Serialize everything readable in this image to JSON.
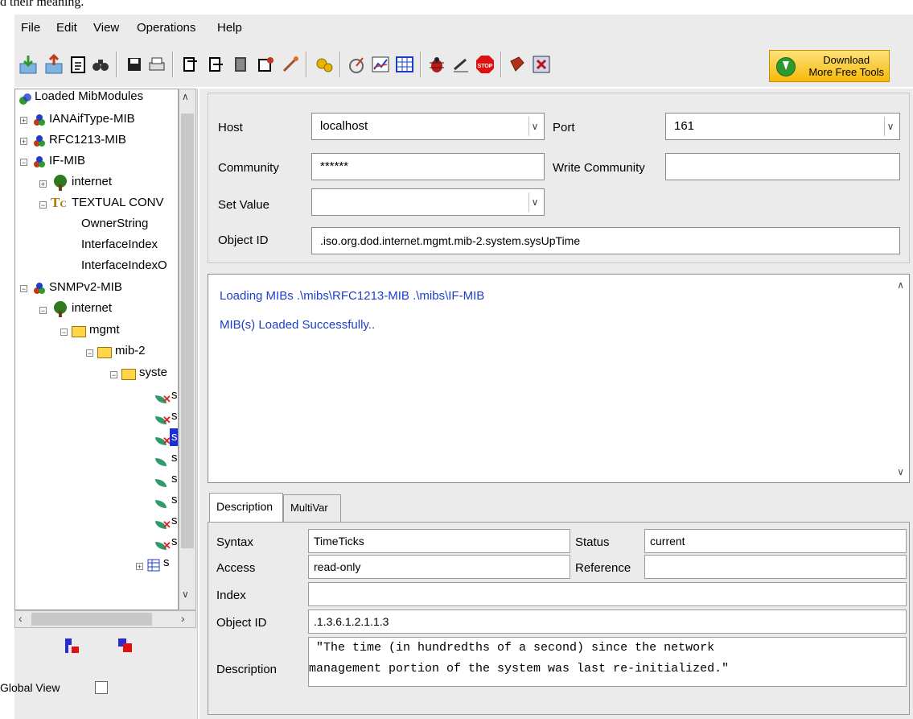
{
  "top_clip_text": "d their meaning.",
  "menu": [
    "File",
    "Edit",
    "View",
    "Operations",
    "Help"
  ],
  "toolbar": {
    "download_line1": "Download",
    "download_line2": "More Free Tools"
  },
  "tree": {
    "root": "Loaded MibModules",
    "items": [
      "IANAifType-MIB",
      "RFC1213-MIB",
      "IF-MIB",
      "internet",
      "TEXTUAL CONV",
      "OwnerString",
      "InterfaceIndex",
      "InterfaceIndexO",
      "SNMPv2-MIB",
      "internet",
      "mgmt",
      "mib-2",
      "syste",
      "s",
      "s",
      "s",
      "s",
      "s",
      "s",
      "s",
      "s",
      "s"
    ]
  },
  "form": {
    "host_label": "Host",
    "host_value": "localhost",
    "port_label": "Port",
    "port_value": "161",
    "community_label": "Community",
    "community_value": "******",
    "write_community_label": "Write Community",
    "write_community_value": "",
    "set_value_label": "Set Value",
    "set_value_value": "",
    "oid_label": "Object ID",
    "oid_value": ".iso.org.dod.internet.mgmt.mib-2.system.sysUpTime"
  },
  "log": [
    "Loading MIBs .\\mibs\\RFC1213-MIB .\\mibs\\IF-MIB",
    "MIB(s) Loaded Successfully.."
  ],
  "tabs": [
    "Description",
    "MultiVar"
  ],
  "details": {
    "syntax_label": "Syntax",
    "syntax_value": "TimeTicks",
    "status_label": "Status",
    "status_value": "current",
    "access_label": "Access",
    "access_value": "read-only",
    "reference_label": "Reference",
    "reference_value": "",
    "index_label": "Index",
    "index_value": "",
    "oid_label": "Object ID",
    "oid_value": ".1.3.6.1.2.1.1.3",
    "description_label": "Description",
    "description_line1": " \"The time (in hundredths of a second) since the network",
    "description_line2": "management portion of the system was last re-initialized.\""
  },
  "global_view_label": "Global View"
}
